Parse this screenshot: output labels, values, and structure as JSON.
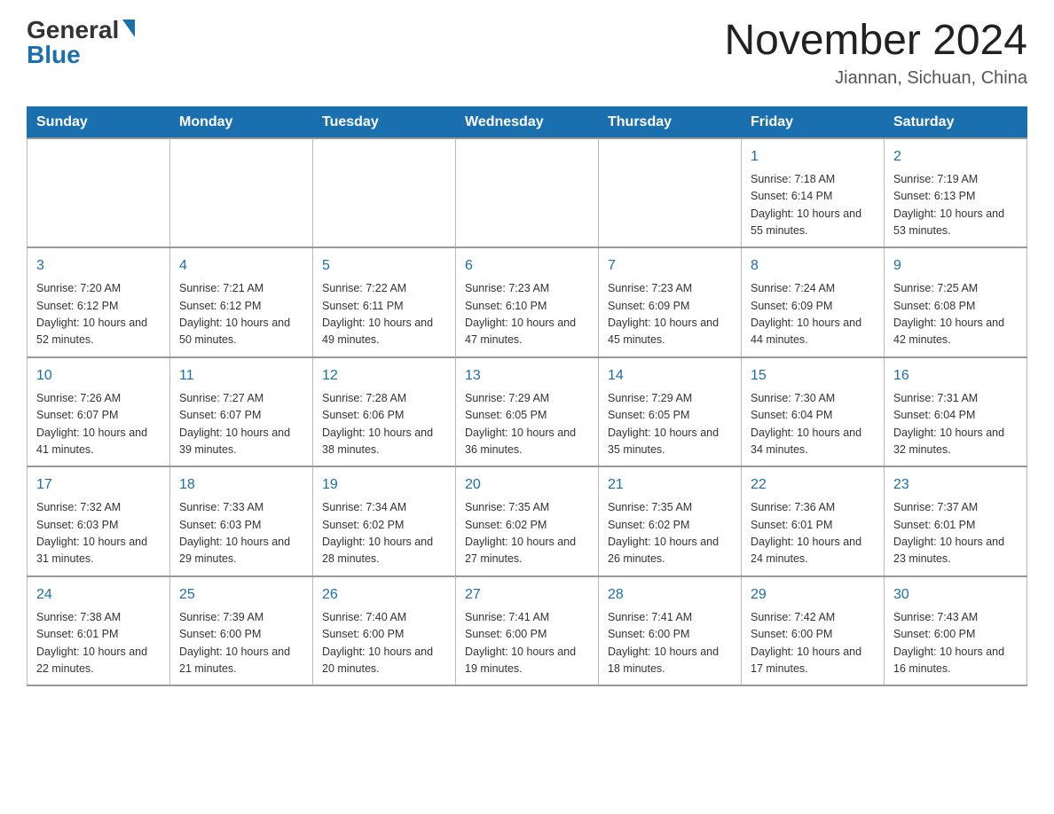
{
  "header": {
    "logo": {
      "general": "General",
      "blue": "Blue"
    },
    "title": "November 2024",
    "location": "Jiannan, Sichuan, China"
  },
  "days_of_week": [
    "Sunday",
    "Monday",
    "Tuesday",
    "Wednesday",
    "Thursday",
    "Friday",
    "Saturday"
  ],
  "weeks": [
    [
      {
        "day": "",
        "info": ""
      },
      {
        "day": "",
        "info": ""
      },
      {
        "day": "",
        "info": ""
      },
      {
        "day": "",
        "info": ""
      },
      {
        "day": "",
        "info": ""
      },
      {
        "day": "1",
        "info": "Sunrise: 7:18 AM\nSunset: 6:14 PM\nDaylight: 10 hours and 55 minutes."
      },
      {
        "day": "2",
        "info": "Sunrise: 7:19 AM\nSunset: 6:13 PM\nDaylight: 10 hours and 53 minutes."
      }
    ],
    [
      {
        "day": "3",
        "info": "Sunrise: 7:20 AM\nSunset: 6:12 PM\nDaylight: 10 hours and 52 minutes."
      },
      {
        "day": "4",
        "info": "Sunrise: 7:21 AM\nSunset: 6:12 PM\nDaylight: 10 hours and 50 minutes."
      },
      {
        "day": "5",
        "info": "Sunrise: 7:22 AM\nSunset: 6:11 PM\nDaylight: 10 hours and 49 minutes."
      },
      {
        "day": "6",
        "info": "Sunrise: 7:23 AM\nSunset: 6:10 PM\nDaylight: 10 hours and 47 minutes."
      },
      {
        "day": "7",
        "info": "Sunrise: 7:23 AM\nSunset: 6:09 PM\nDaylight: 10 hours and 45 minutes."
      },
      {
        "day": "8",
        "info": "Sunrise: 7:24 AM\nSunset: 6:09 PM\nDaylight: 10 hours and 44 minutes."
      },
      {
        "day": "9",
        "info": "Sunrise: 7:25 AM\nSunset: 6:08 PM\nDaylight: 10 hours and 42 minutes."
      }
    ],
    [
      {
        "day": "10",
        "info": "Sunrise: 7:26 AM\nSunset: 6:07 PM\nDaylight: 10 hours and 41 minutes."
      },
      {
        "day": "11",
        "info": "Sunrise: 7:27 AM\nSunset: 6:07 PM\nDaylight: 10 hours and 39 minutes."
      },
      {
        "day": "12",
        "info": "Sunrise: 7:28 AM\nSunset: 6:06 PM\nDaylight: 10 hours and 38 minutes."
      },
      {
        "day": "13",
        "info": "Sunrise: 7:29 AM\nSunset: 6:05 PM\nDaylight: 10 hours and 36 minutes."
      },
      {
        "day": "14",
        "info": "Sunrise: 7:29 AM\nSunset: 6:05 PM\nDaylight: 10 hours and 35 minutes."
      },
      {
        "day": "15",
        "info": "Sunrise: 7:30 AM\nSunset: 6:04 PM\nDaylight: 10 hours and 34 minutes."
      },
      {
        "day": "16",
        "info": "Sunrise: 7:31 AM\nSunset: 6:04 PM\nDaylight: 10 hours and 32 minutes."
      }
    ],
    [
      {
        "day": "17",
        "info": "Sunrise: 7:32 AM\nSunset: 6:03 PM\nDaylight: 10 hours and 31 minutes."
      },
      {
        "day": "18",
        "info": "Sunrise: 7:33 AM\nSunset: 6:03 PM\nDaylight: 10 hours and 29 minutes."
      },
      {
        "day": "19",
        "info": "Sunrise: 7:34 AM\nSunset: 6:02 PM\nDaylight: 10 hours and 28 minutes."
      },
      {
        "day": "20",
        "info": "Sunrise: 7:35 AM\nSunset: 6:02 PM\nDaylight: 10 hours and 27 minutes."
      },
      {
        "day": "21",
        "info": "Sunrise: 7:35 AM\nSunset: 6:02 PM\nDaylight: 10 hours and 26 minutes."
      },
      {
        "day": "22",
        "info": "Sunrise: 7:36 AM\nSunset: 6:01 PM\nDaylight: 10 hours and 24 minutes."
      },
      {
        "day": "23",
        "info": "Sunrise: 7:37 AM\nSunset: 6:01 PM\nDaylight: 10 hours and 23 minutes."
      }
    ],
    [
      {
        "day": "24",
        "info": "Sunrise: 7:38 AM\nSunset: 6:01 PM\nDaylight: 10 hours and 22 minutes."
      },
      {
        "day": "25",
        "info": "Sunrise: 7:39 AM\nSunset: 6:00 PM\nDaylight: 10 hours and 21 minutes."
      },
      {
        "day": "26",
        "info": "Sunrise: 7:40 AM\nSunset: 6:00 PM\nDaylight: 10 hours and 20 minutes."
      },
      {
        "day": "27",
        "info": "Sunrise: 7:41 AM\nSunset: 6:00 PM\nDaylight: 10 hours and 19 minutes."
      },
      {
        "day": "28",
        "info": "Sunrise: 7:41 AM\nSunset: 6:00 PM\nDaylight: 10 hours and 18 minutes."
      },
      {
        "day": "29",
        "info": "Sunrise: 7:42 AM\nSunset: 6:00 PM\nDaylight: 10 hours and 17 minutes."
      },
      {
        "day": "30",
        "info": "Sunrise: 7:43 AM\nSunset: 6:00 PM\nDaylight: 10 hours and 16 minutes."
      }
    ]
  ]
}
